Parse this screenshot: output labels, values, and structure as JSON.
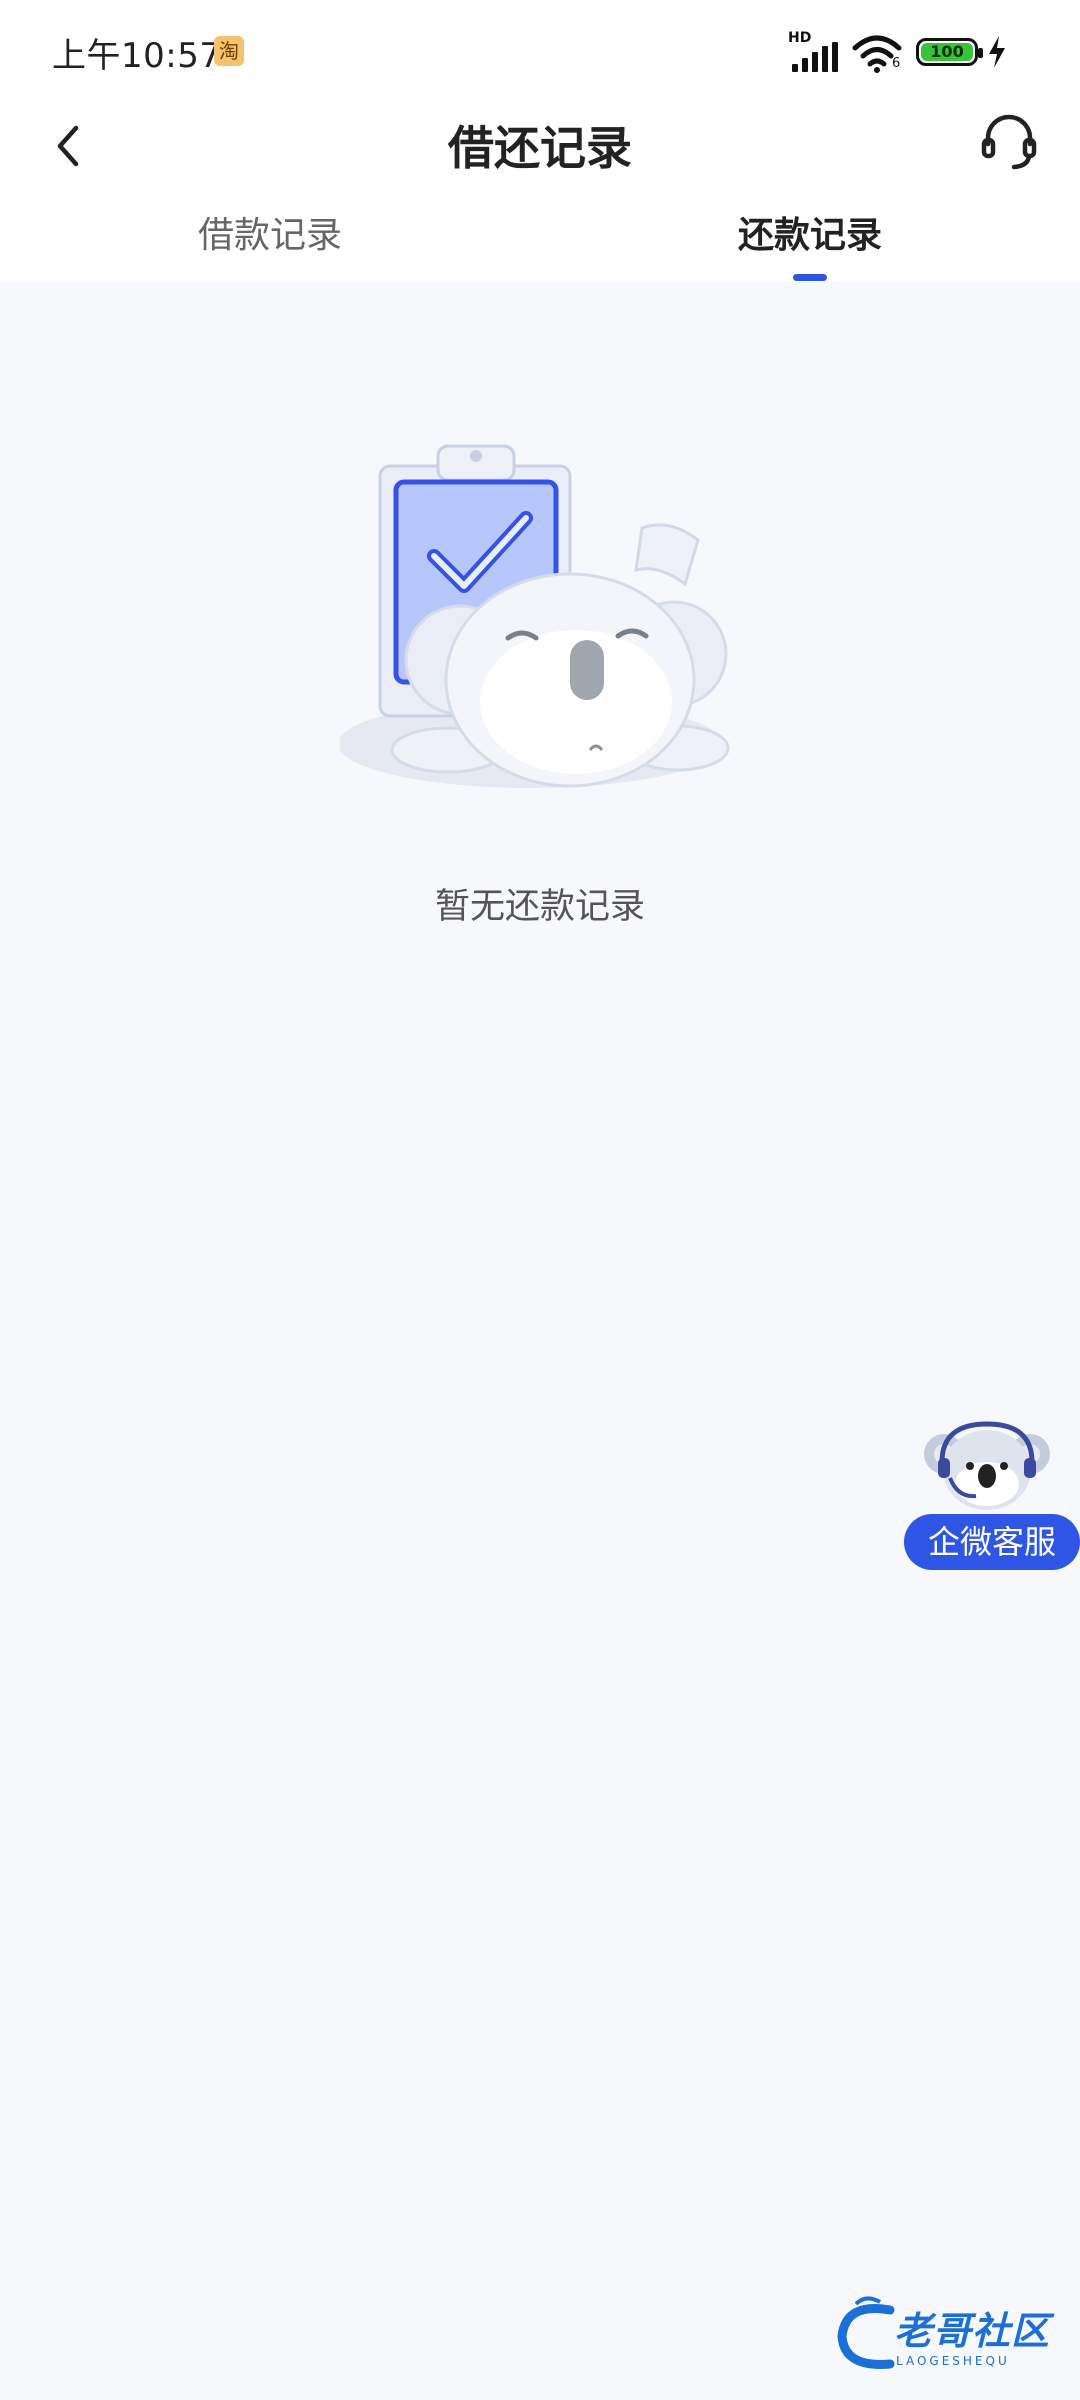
{
  "status_bar": {
    "time": "上午10:57",
    "app_badge": "淘",
    "network_badge": "HD",
    "wifi_badge": "6",
    "battery": "100"
  },
  "nav": {
    "title": "借还记录",
    "back_icon": "chevron-left-icon",
    "service_icon": "headset-icon"
  },
  "tabs": [
    {
      "label": "借款记录",
      "active": false
    },
    {
      "label": "还款记录",
      "active": true
    }
  ],
  "empty_state": {
    "message": "暂无还款记录",
    "illustration": "koala-sleeping-clipboard-illustration"
  },
  "floating_service": {
    "label": "企微客服",
    "icon": "koala-headset-icon"
  },
  "watermark": {
    "text": "老哥社区",
    "subtext": "LAOGESHEQU"
  },
  "colors": {
    "accent": "#2f55e4",
    "background": "#f7f8fc",
    "header": "#ffffff"
  }
}
